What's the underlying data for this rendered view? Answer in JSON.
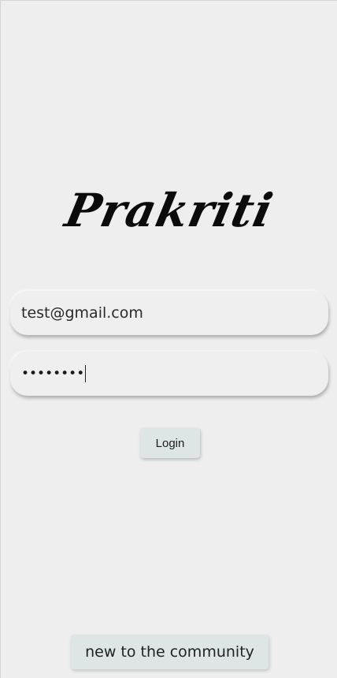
{
  "app": {
    "title": "Prakriti"
  },
  "login_form": {
    "email_value": "test@gmail.com",
    "password_masked": "••••••••",
    "login_label": "Login"
  },
  "footer": {
    "signup_label": "new to the community"
  },
  "colors": {
    "background": "#eeeeee",
    "button_bg": "#dde5e7",
    "text": "#0b0b0b"
  }
}
